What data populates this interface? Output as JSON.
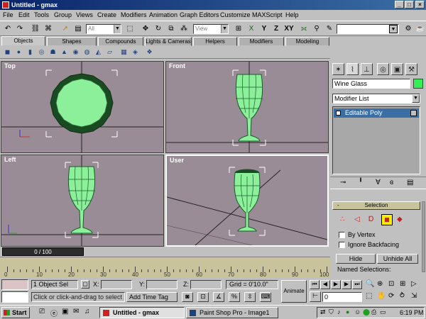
{
  "window": {
    "title": "Untitled - gmax",
    "min_glyph": "_",
    "max_glyph": "□",
    "close_glyph": "×"
  },
  "menu": [
    "File",
    "Edit",
    "Tools",
    "Group",
    "Views",
    "Create",
    "Modifiers",
    "Animation",
    "Graph Editors",
    "Customize",
    "MAXScript",
    "Help"
  ],
  "toolbar": {
    "filter": "All",
    "view": "View",
    "axis_x": "X",
    "axis_y": "Y",
    "axis_z": "Z",
    "axis_xy": "XY"
  },
  "tabs": [
    "Objects",
    "Shapes",
    "Compounds",
    "Lights & Cameras",
    "Helpers",
    "Modifiers",
    "Modeling"
  ],
  "viewports": {
    "top": "Top",
    "front": "Front",
    "left": "Left",
    "user": "User"
  },
  "command_panel": {
    "object_name": "Wine Glass",
    "object_color": "#33ee55",
    "modifier_list": "Modifier List",
    "stack_item": "Editable Poly",
    "selection_rollout": "Selection",
    "rollout_toggle": "-",
    "by_vertex": "By Vertex",
    "ignore_backfacing": "Ignore Backfacing",
    "hide": "Hide",
    "unhide_all": "Unhide All",
    "named_selections": "Named Selections:"
  },
  "timeline": {
    "frame": "0 / 100",
    "ticks": [
      "0",
      "10",
      "20",
      "30",
      "40",
      "50",
      "60",
      "70",
      "80",
      "90",
      "100"
    ]
  },
  "status": {
    "selection": "1 Object Sel",
    "prompt": "Click or click-and-drag to select obje",
    "add_time_tag": "Add Time Tag",
    "x_label": "X:",
    "y_label": "Y:",
    "z_label": "Z:",
    "grid": "Grid = 0'10.0\"",
    "animate": "Animate",
    "frame_value": "0"
  },
  "taskbar": {
    "start": "Start",
    "tasks": [
      "Untitled - gmax",
      "Paint Shop Pro - Image1"
    ],
    "clock": "6:19 PM"
  },
  "colors": {
    "viewport_bg": "#9a8c97",
    "mesh_green": "#88ee88",
    "mesh_dark": "#1a5a2a",
    "title_blue": "#0a246a",
    "selection_yellow": "#ffee00"
  }
}
